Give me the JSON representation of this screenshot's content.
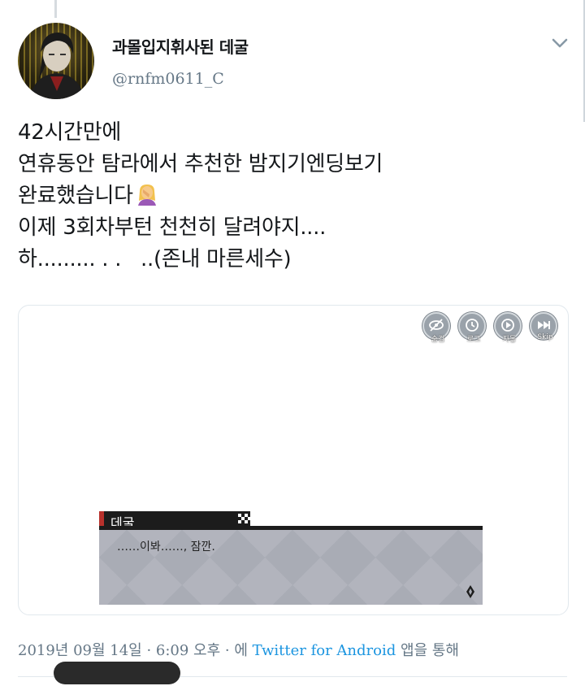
{
  "tweet": {
    "display_name": "과몰입지휘사된 데굴",
    "handle": "@rnfm0611_C",
    "lines": [
      "42시간만에",
      "연휴동안 탐라에서 추천한 밤지기엔딩보기",
      "완료했습니다",
      "이제 3회차부턴 천천히 달려야지....",
      "하......... . .   ..(존내 마른세수)"
    ],
    "emoji": "facepalm-emoji"
  },
  "media": {
    "buttons": [
      {
        "icon": "eye-slash-icon",
        "label": "숨김"
      },
      {
        "icon": "history-icon",
        "label": "로그"
      },
      {
        "icon": "play-icon",
        "label": "자동"
      },
      {
        "icon": "fast-forward-icon",
        "label": "Skip"
      }
    ],
    "speaker": "데굴",
    "dialogue": "……이봐……, 잠깐."
  },
  "footer": {
    "date": "2019년 09월 14일 · 6:09 오후 · 에 ",
    "source": "Twitter for Android",
    "suffix": " 앱을 통해"
  },
  "colors": {
    "text": "#14171a",
    "secondary": "#657786",
    "link": "#1b95e0",
    "name_accent": "#b7312c"
  }
}
